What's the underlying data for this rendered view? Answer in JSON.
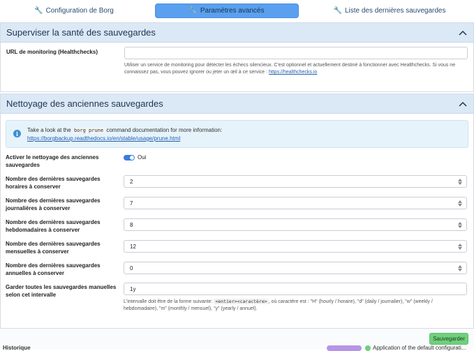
{
  "tabs": [
    {
      "label": "Configuration de Borg",
      "icon": "wrench-icon"
    },
    {
      "label": "Paramètres avancés",
      "icon": "wrench-icon",
      "active": true
    },
    {
      "label": "Liste des dernières sauvegardes",
      "icon": "wrench-icon"
    }
  ],
  "health": {
    "title": "Superviser la santé des sauvegardes",
    "url_label": "URL de monitoring (Healthchecks)",
    "url_value": "",
    "help_text": "Utiliser un service de monitoring pour détecter les échecs silencieux. C'est optionnel et actuellement destiné à fonctionner avec Healthchecks. Si vous ne connaissez pas, vous pouvez ignorer ou jeter un œil à ce service :",
    "help_link": "https://healthchecks.io"
  },
  "prune": {
    "title": "Nettoyage des anciennes sauvegardes",
    "info_prefix": "Take a look at the",
    "info_code": "borg prune",
    "info_suffix": "command documentation for more information:",
    "info_link": "https://borgbackup.readthedocs.io/en/stable/usage/prune.html",
    "enable_label": "Activer le nettoyage des anciennes sauvegardes",
    "enable_value": "Oui",
    "fields": [
      {
        "label": "Nombre des dernières sauvegardes horaires à conserver",
        "value": "2"
      },
      {
        "label": "Nombre des dernières sauvegardes journalières à conserver",
        "value": "7"
      },
      {
        "label": "Nombre des dernières sauvegardes hebdomadaires à conserver",
        "value": "8"
      },
      {
        "label": "Nombre des dernières sauvegardes mensuelles à conserver",
        "value": "12"
      },
      {
        "label": "Nombre des dernières sauvegardes annuelles à conserver",
        "value": "0"
      }
    ],
    "keep_label": "Garder toutes les sauvegardes manuelles selon cet intervalle",
    "keep_value": "1y",
    "keep_help_1": "L'intervalle doit être de la forme suivante:",
    "keep_help_code": "<entier><caractère>",
    "keep_help_2": ", où caractère est : \"H\" (hourly / horaire), \"d\" (daily / journalier), \"w\" (weekly / hebdomadaire), \"m\" (monthly / mensuel), \"y\" (yearly / annuel)."
  },
  "footer": {
    "save_label": "Sauvegarder",
    "history_label": "Historique",
    "cut_text": "Application of the default configurati..."
  },
  "colors": {
    "active_tab": "#5aa0ee",
    "section_header": "#dbe8f6",
    "save_button": "#6fd07d",
    "toggle_on": "#3b7ddd"
  }
}
